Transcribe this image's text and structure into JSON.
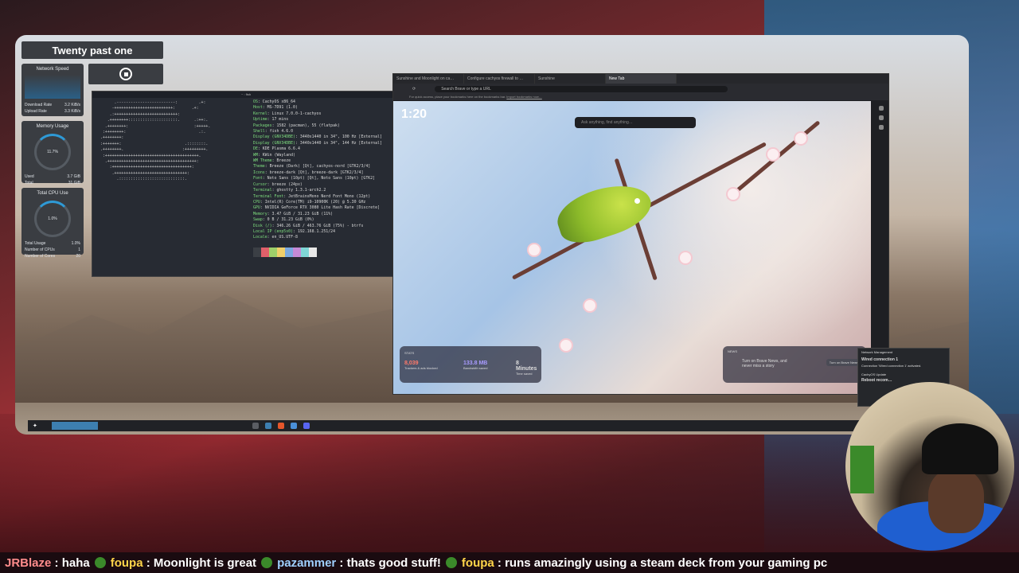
{
  "widgets": {
    "clock_text": "Twenty past one",
    "network": {
      "title": "Network Speed",
      "rows": [
        {
          "k": "Download Rate",
          "v": "3.2 KiB/s"
        },
        {
          "k": "Upload Rate",
          "v": "3.3 KiB/s"
        }
      ]
    },
    "memory": {
      "title": "Memory Usage",
      "center": "11.7%",
      "rows": [
        {
          "k": "Used",
          "v": "3.7 GiB"
        },
        {
          "k": "Total",
          "v": "31 GiB"
        }
      ]
    },
    "cpu": {
      "title": "Total CPU Use",
      "center": "1.0%",
      "rows": [
        {
          "k": "Total Usage",
          "v": "1.0%"
        },
        {
          "k": "Number of CPUs",
          "v": "1"
        },
        {
          "k": "Number of Cores",
          "v": "20"
        }
      ]
    }
  },
  "terminal": {
    "title": "~ : fish",
    "info": [
      [
        "OS",
        "CachyOS x86_64"
      ],
      [
        "Host",
        "MS-7D91 (1.0)"
      ],
      [
        "Kernel",
        "Linux 7.0.0-1-cachyos"
      ],
      [
        "Uptime",
        "17 mins"
      ],
      [
        "Packages",
        "1582 (pacman), 55 (flatpak)"
      ],
      [
        "Shell",
        "fish 4.6.0"
      ],
      [
        "Display (GNV34DBE)",
        "3440x1440 in 34\", 100 Hz [External]"
      ],
      [
        "Display (GNV34DBE)",
        "3440x1440 in 34\", 144 Hz [External]"
      ],
      [
        "DE",
        "KDE Plasma 6.6.4"
      ],
      [
        "WM",
        "KWin (Wayland)"
      ],
      [
        "WM Theme",
        "Breeze"
      ],
      [
        "Theme",
        "Breeze (Dark) [Qt], cachyos-nord [GTK2/3/4]"
      ],
      [
        "Icons",
        "breeze-dark [Qt], breeze-dark [GTK2/3/4]"
      ],
      [
        "Font",
        "Noto Sans (10pt) [Qt], Noto Sans (10pt) [GTK2]"
      ],
      [
        "Cursor",
        "breeze (24px)"
      ],
      [
        "Terminal",
        "ghostty 1.3.1-arch2.2"
      ],
      [
        "Terminal Font",
        "JetBrainsMono Nerd Font Mono (12pt)"
      ],
      [
        "CPU",
        "Intel(R) Core(TM) i9-10900K (20) @ 5.30 GHz"
      ],
      [
        "GPU",
        "NVIDIA GeForce RTX 3080 Lite Hash Rate [Discrete]"
      ],
      [
        "Memory",
        "3.47 GiB / 31.23 GiB (11%)"
      ],
      [
        "Swap",
        "0 B / 31.23 GiB (0%)"
      ],
      [
        "Disk (/)",
        "346.26 GiB / 463.76 GiB (75%) - btrfs"
      ],
      [
        "Local IP (enp5s0)",
        "192.168.1.251/24"
      ],
      [
        "Locale",
        "en_US.UTF-8"
      ]
    ]
  },
  "browser": {
    "tabs": [
      "Sunshine and Moonlight on ca…",
      "Configure cachyos firewall to …",
      "Sunshine",
      "New Tab"
    ],
    "active_tab": 3,
    "url_placeholder": "Search Brave or type a URL",
    "bookmark_hint": "For quick access, place your bookmarks here on the bookmarks bar.",
    "bookmark_link": "Import bookmarks now…",
    "clock": "1:20",
    "search_placeholder": "Ask anything, find anything…",
    "stats": {
      "label": "STATS",
      "items": [
        {
          "value": "8,039",
          "label": "Trackers & ads blocked"
        },
        {
          "value": "133.8 MB",
          "label": "Bandwidth saved"
        },
        {
          "value": "8 Minutes",
          "label": "Time saved"
        }
      ]
    },
    "news": {
      "label": "NEWS",
      "text": "Turn on Brave News, and never miss a story",
      "button": "Turn on Brave News"
    }
  },
  "notification": {
    "app": "Network Management",
    "title": "Wired connection 1",
    "body": "Connection 'Wired connection 1' activated.",
    "update_app": "CachyOS Update",
    "update_title": "Reboot recom…"
  },
  "ticker": [
    {
      "user": "JRBlaze",
      "msg": "haha"
    },
    {
      "user": "foupa",
      "msg": "Moonlight is great"
    },
    {
      "user": "pazammer",
      "msg": "thats good stuff!"
    },
    {
      "user": "foupa",
      "msg": "runs amazingly using a steam deck from your gaming pc"
    }
  ]
}
